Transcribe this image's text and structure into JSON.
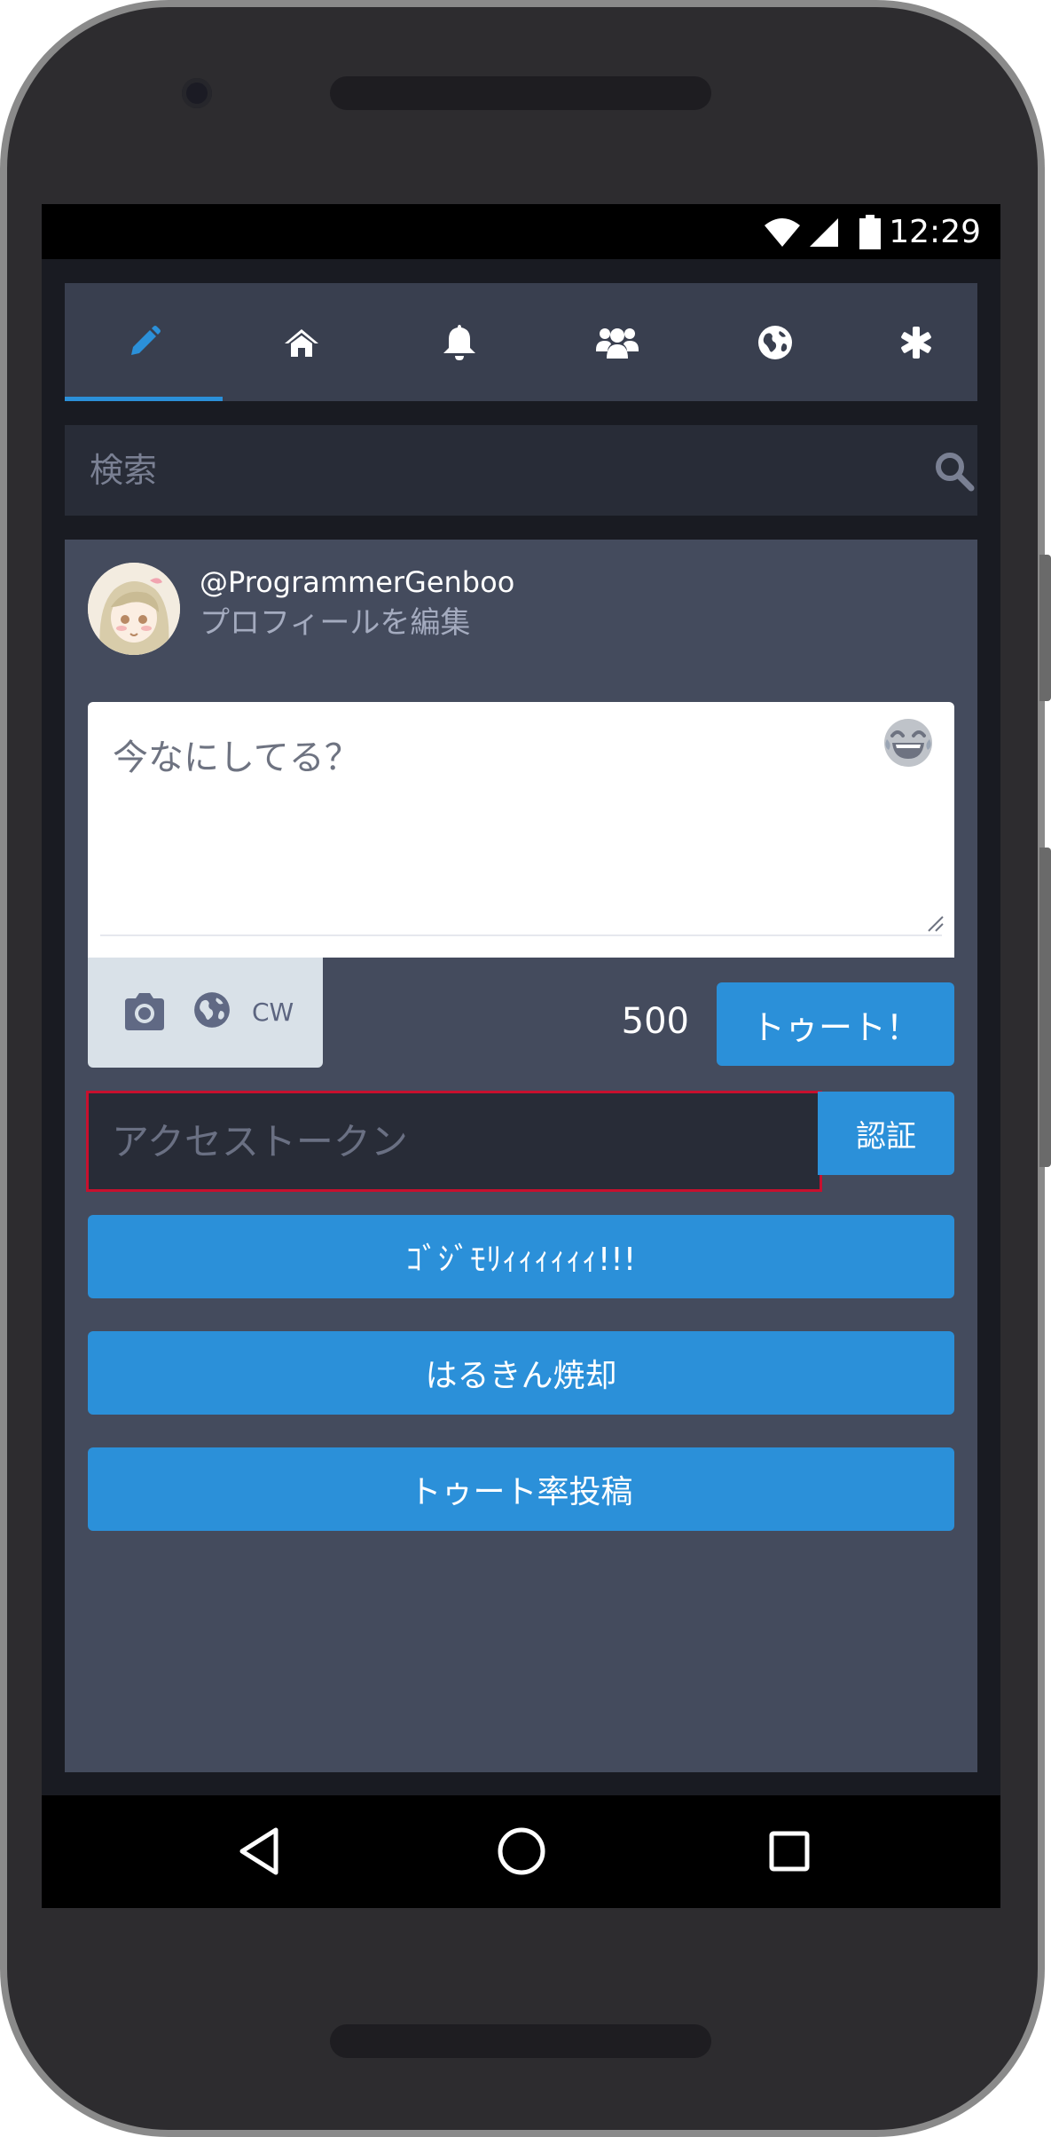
{
  "status_bar": {
    "time": "12:29"
  },
  "tabs": [
    {
      "id": "compose",
      "icon": "pencil-icon",
      "active": true
    },
    {
      "id": "home",
      "icon": "home-icon",
      "active": false
    },
    {
      "id": "notifications",
      "icon": "bell-icon",
      "active": false
    },
    {
      "id": "local",
      "icon": "users-icon",
      "active": false
    },
    {
      "id": "federated",
      "icon": "globe-icon",
      "active": false
    },
    {
      "id": "settings",
      "icon": "asterisk-icon",
      "active": false
    }
  ],
  "search": {
    "placeholder": "検索"
  },
  "profile": {
    "username": "@ProgrammerGenboo",
    "edit_profile_label": "プロフィールを編集"
  },
  "compose": {
    "placeholder": "今なにしてる？",
    "cw_label": "CW",
    "char_count": "500",
    "toot_label": "トゥート！"
  },
  "access_token": {
    "placeholder": "アクセストークン",
    "auth_label": "認証"
  },
  "actions": [
    {
      "label": "ｺﾞｼﾞﾓﾘｨｨｨｨｨｨ!!!"
    },
    {
      "label": "はるきん焼却"
    },
    {
      "label": "トゥート率投稿"
    }
  ],
  "colors": {
    "accent": "#2b90d9",
    "panel": "#444b5d",
    "tab_bar": "#393f4f",
    "input_bg": "#282c37",
    "error_border": "#c8102e"
  }
}
